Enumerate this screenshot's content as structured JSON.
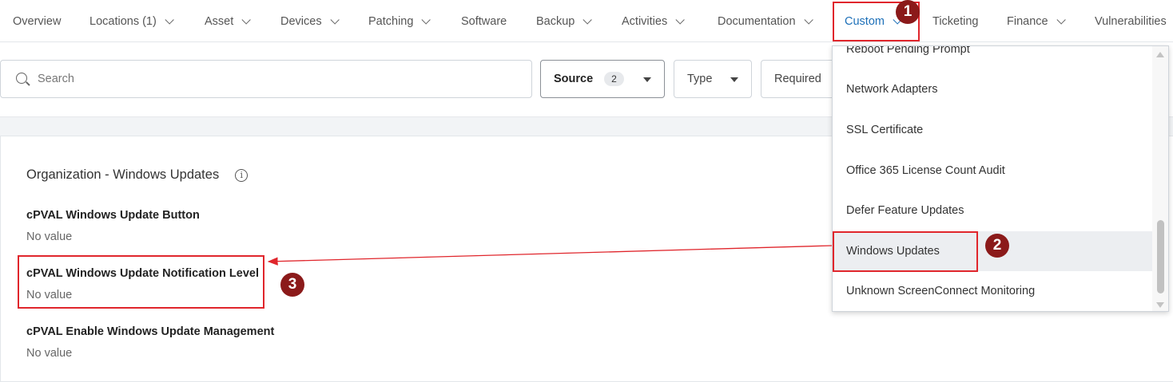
{
  "tabs": [
    {
      "label": "Overview",
      "has_chevron": false
    },
    {
      "label": "Locations (1)",
      "has_chevron": true
    },
    {
      "label": "Asset",
      "has_chevron": true
    },
    {
      "label": "Devices",
      "has_chevron": true
    },
    {
      "label": "Patching",
      "has_chevron": true
    },
    {
      "label": "Software",
      "has_chevron": false
    },
    {
      "label": "Backup",
      "has_chevron": true
    },
    {
      "label": "Activities",
      "has_chevron": true
    },
    {
      "label": "Documentation",
      "has_chevron": true
    },
    {
      "label": "Custom",
      "has_chevron": true,
      "active": true
    },
    {
      "label": "Ticketing",
      "has_chevron": false
    },
    {
      "label": "Finance",
      "has_chevron": true
    },
    {
      "label": "Vulnerabilities",
      "has_chevron": false
    }
  ],
  "search": {
    "placeholder": "Search",
    "value": ""
  },
  "filters": {
    "source": {
      "label": "Source",
      "count": "2"
    },
    "type": {
      "label": "Type"
    },
    "required": {
      "label": "Required"
    }
  },
  "section": {
    "title": "Organization - Windows Updates",
    "info_icon": "info-icon"
  },
  "fields": [
    {
      "label": "cPVAL Windows Update Button",
      "value": "No value"
    },
    {
      "label": "cPVAL Windows Update Notification Level",
      "value": "No value"
    },
    {
      "label": "cPVAL Enable Windows Update Management",
      "value": "No value"
    }
  ],
  "custom_menu": {
    "items": [
      "Reboot Pending Prompt",
      "Network Adapters",
      "SSL Certificate",
      "Office 365 License Count Audit",
      "Defer Feature Updates",
      "Windows Updates",
      "Unknown ScreenConnect Monitoring"
    ],
    "highlighted": "Windows Updates"
  },
  "annotations": {
    "markers": [
      "1",
      "2",
      "3"
    ],
    "color": "#e0262c",
    "marker_color": "#8b1a1a"
  },
  "colors": {
    "accent": "#1c6fb8"
  }
}
